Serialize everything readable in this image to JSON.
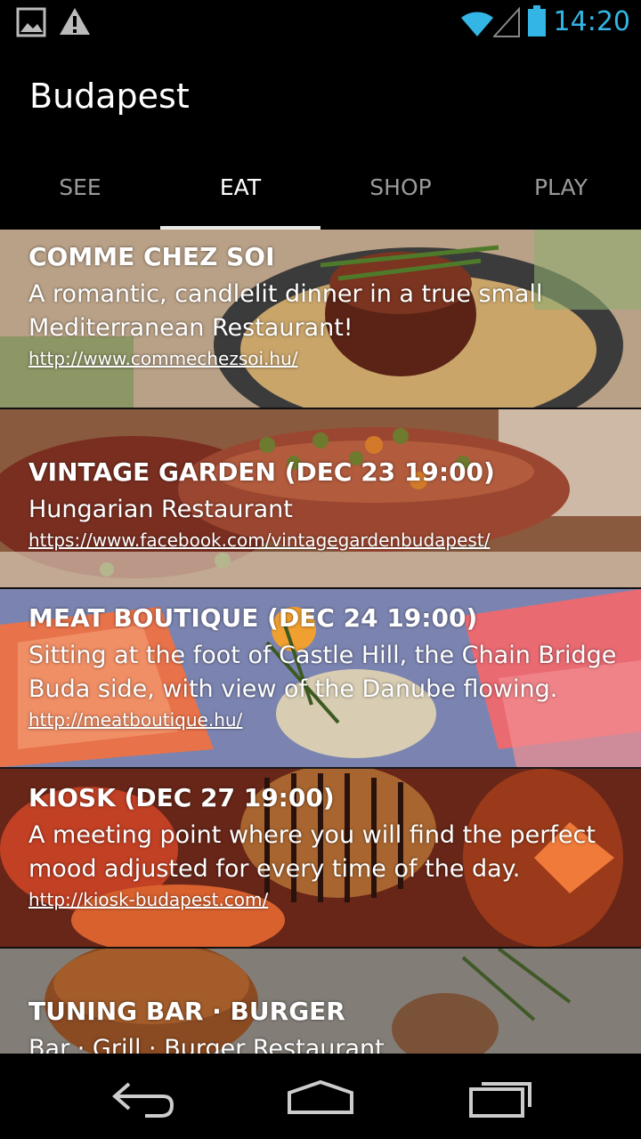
{
  "status_bar": {
    "time": "14:20",
    "icons": [
      "image-notification-icon",
      "warning-icon",
      "wifi-icon",
      "signal-icon",
      "battery-icon"
    ],
    "accent_color": "#33b5e5"
  },
  "app_bar": {
    "title": "Budapest"
  },
  "tabs": [
    {
      "label": "SEE",
      "active": false
    },
    {
      "label": "EAT",
      "active": true
    },
    {
      "label": "SHOP",
      "active": false
    },
    {
      "label": "PLAY",
      "active": false
    }
  ],
  "restaurants": [
    {
      "title": "COMME CHEZ SOI",
      "desc_lines": [
        "A romantic, candlelit dinner in a true small",
        "Mediterranean Restaurant!"
      ],
      "link": "http://www.commechezsoi.hu/"
    },
    {
      "title": "VINTAGE GARDEN (DEC 23 19:00)",
      "desc_lines": [
        "Hungarian Restaurant"
      ],
      "link": "https://www.facebook.com/vintagegardenbudapest/"
    },
    {
      "title": "MEAT BOUTIQUE (DEC 24 19:00)",
      "desc_lines": [
        "Sitting at the foot of Castle Hill, the Chain Bridge",
        "Buda side, with view of the Danube flowing."
      ],
      "link": "http://meatboutique.hu/"
    },
    {
      "title": "KIOSK (DEC 27 19:00)",
      "desc_lines": [
        "A meeting point where you will find the perfect",
        "mood adjusted for every time of the day."
      ],
      "link": "http://kiosk-budapest.com/"
    },
    {
      "title": "TUNING BAR · BURGER",
      "desc_lines": [
        "Bar · Grill · Burger Restaurant"
      ],
      "link": ""
    }
  ],
  "nav_bar": {
    "buttons": [
      "back-icon",
      "home-icon",
      "recent-apps-icon"
    ]
  }
}
